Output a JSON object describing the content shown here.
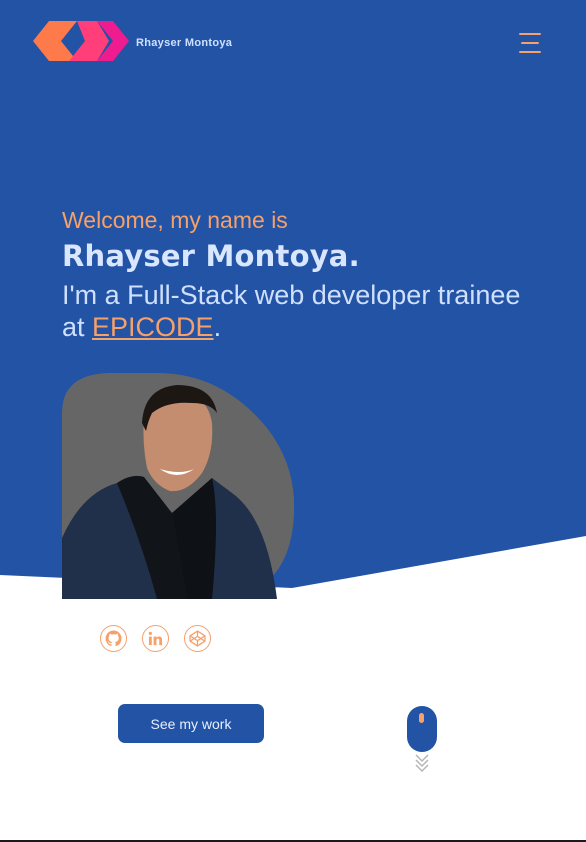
{
  "header": {
    "brand_name": "Rhayser Montoya",
    "logo_icon": "chevrons-logo-icon",
    "menu_icon": "hamburger-menu-icon"
  },
  "hero": {
    "greeting": "Welcome, my name is",
    "name": "Rhayser Montoya.",
    "tagline_prefix": "I'm a Full-Stack web developer trainee at ",
    "tagline_link": "EPICODE",
    "tagline_suffix": "."
  },
  "social_links": [
    {
      "icon": "github-icon"
    },
    {
      "icon": "linkedin-icon"
    },
    {
      "icon": "codepen-icon"
    }
  ],
  "cta": {
    "label": "See my work"
  },
  "scroll_indicator": {
    "icon": "scroll-mouse-icon"
  },
  "colors": {
    "hero_background": "#2353a5",
    "accent_orange": "#f6a06a",
    "accent_pink": "#ee1c8e",
    "text_light": "#cfe0ff",
    "portrait_background": "#666666"
  }
}
